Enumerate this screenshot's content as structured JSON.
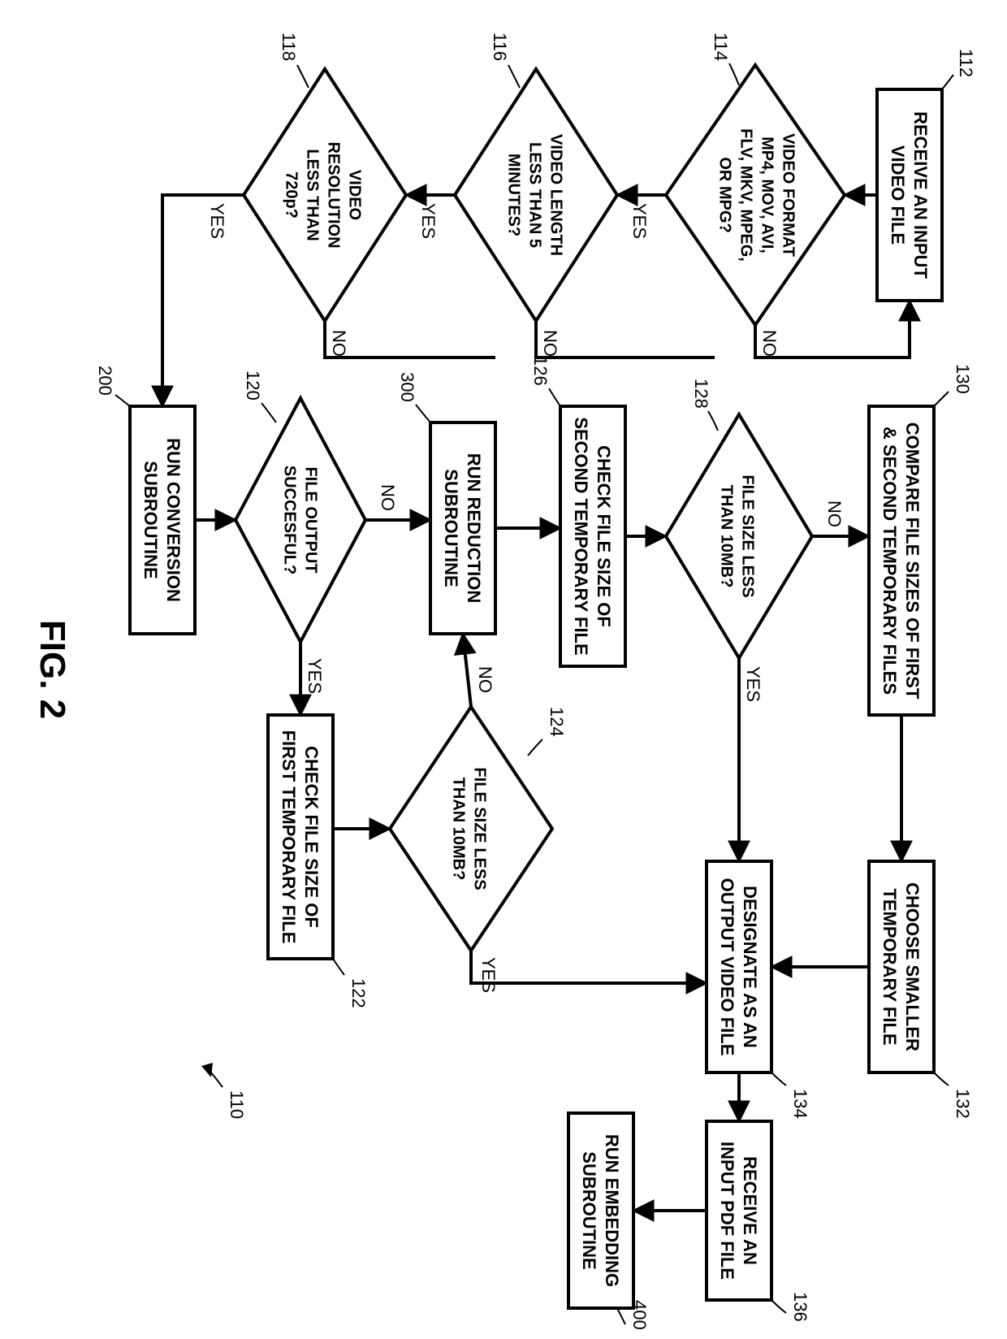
{
  "figure_label": "FIG. 2",
  "flow_ref": "110",
  "nodes": {
    "n112": {
      "ref": "112",
      "lines": [
        "RECEIVE AN INPUT",
        "VIDEO FILE"
      ]
    },
    "n114": {
      "ref": "114",
      "lines": [
        "VIDEO FORMAT",
        "MP4, MOV, AVI,",
        "FLV, MKV, MPEG,",
        "OR MPG?"
      ]
    },
    "n116": {
      "ref": "116",
      "lines": [
        "VIDEO LENGTH",
        "LESS THAN 5",
        "MINUTES?"
      ]
    },
    "n118": {
      "ref": "118",
      "lines": [
        "VIDEO",
        "RESOLUTION",
        "LESS THAN",
        "720p?"
      ]
    },
    "n200": {
      "ref": "200",
      "lines": [
        "RUN CONVERSION",
        "SUBROUTINE"
      ]
    },
    "n120": {
      "ref": "120",
      "lines": [
        "FILE OUTPUT",
        "SUCCESFUL?"
      ]
    },
    "n300": {
      "ref": "300",
      "lines": [
        "RUN REDUCTION",
        "SUBROUTINE"
      ]
    },
    "n122": {
      "ref": "122",
      "lines": [
        "CHECK FILE SIZE OF",
        "FIRST TEMPORARY FILE"
      ]
    },
    "n124": {
      "ref": "124",
      "lines": [
        "FILE SIZE LESS",
        "THAN 10MB?"
      ]
    },
    "n126": {
      "ref": "126",
      "lines": [
        "CHECK FILE SIZE OF",
        "SECOND TEMPORARY FILE"
      ]
    },
    "n128": {
      "ref": "128",
      "lines": [
        "FILE SIZE LESS",
        "THAN 10MB?"
      ]
    },
    "n130": {
      "ref": "130",
      "lines": [
        "COMPARE FILE SIZES OF FIRST",
        "& SECOND TEMPORARY FILES"
      ]
    },
    "n132": {
      "ref": "132",
      "lines": [
        "CHOOSE SMALLER",
        "TEMPORARY FILE"
      ]
    },
    "n134": {
      "ref": "134",
      "lines": [
        "DESIGNATE AS AN",
        "OUTPUT VIDEO FILE"
      ]
    },
    "n136": {
      "ref": "136",
      "lines": [
        "RECEIVE AN",
        "INPUT PDF FILE"
      ]
    },
    "n400": {
      "ref": "400",
      "lines": [
        "RUN EMBEDDING",
        "SUBROUTINE"
      ]
    }
  },
  "edge_labels": {
    "yes": "YES",
    "no": "NO"
  }
}
